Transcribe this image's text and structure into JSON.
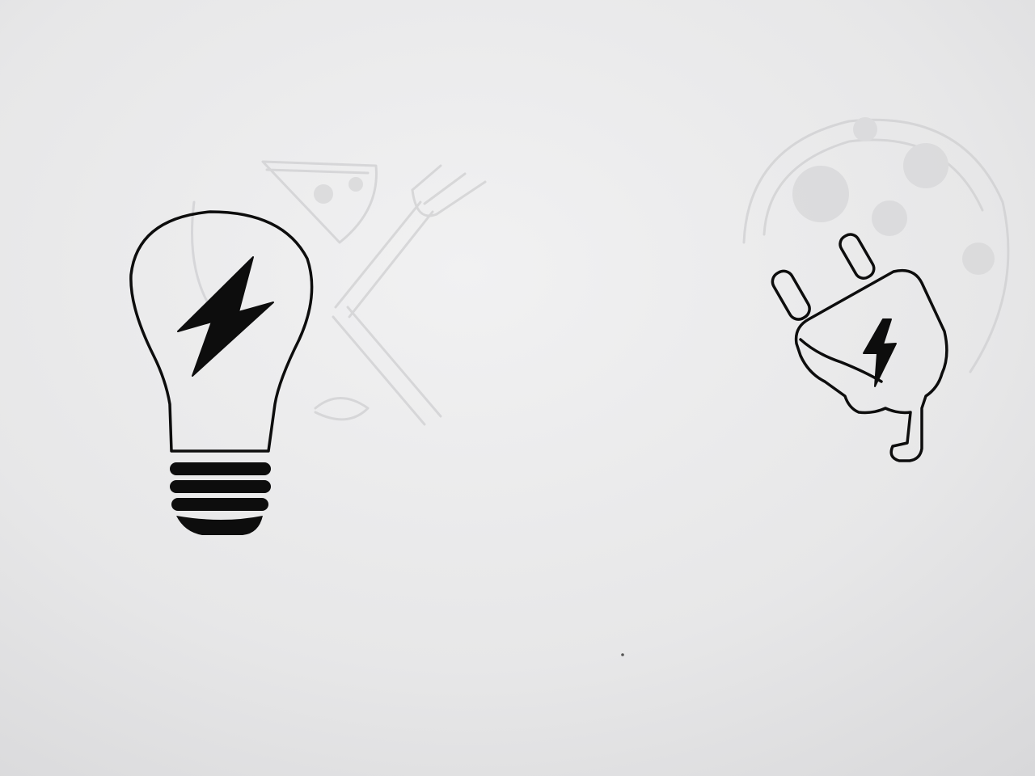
{
  "scene": {
    "description_type": "photo-of-paper-sketch",
    "paper_color": "#e9e9ea",
    "ink_color": "#0d0d0d",
    "bleed_color": "#cfcfd1",
    "drawings": [
      {
        "subject": "light-bulb",
        "icon": "lightbulb-icon",
        "detail": "lightning-bolt-icon"
      },
      {
        "subject": "electric-plug",
        "icon": "plug-icon",
        "detail": "lightning-bolt-icon"
      }
    ],
    "show_through": [
      {
        "subject": "pizza-slice",
        "icon": "pizza-slice-icon"
      },
      {
        "subject": "fork",
        "icon": "fork-icon"
      },
      {
        "subject": "pizza",
        "icon": "pizza-icon"
      }
    ]
  }
}
